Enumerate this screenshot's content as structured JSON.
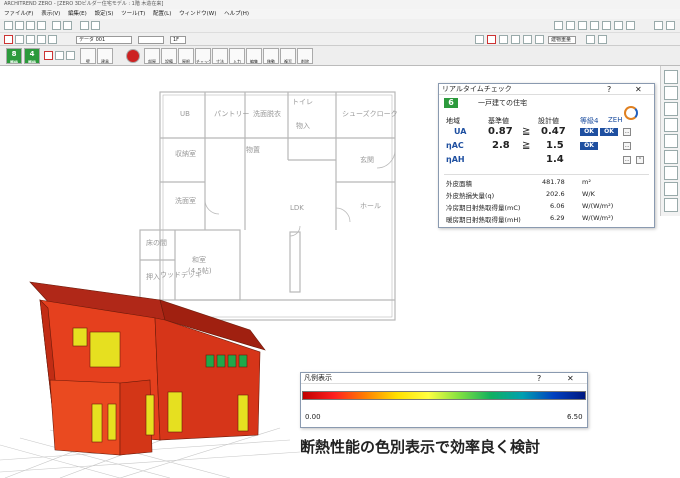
{
  "window": {
    "title": "ARCHITREND ZERO - [ZERO 3Dビルダー住宅モデル : 1階 木造在来]",
    "menu": [
      "ファイル(F)",
      "表示(V)",
      "編集(E)",
      "設定(S)",
      "ツール(T)",
      "配置(L)",
      "ウィンドウ(W)",
      "ヘルプ(H)"
    ]
  },
  "toolbar": {
    "grade_main": "8",
    "grade_sub": "4",
    "grade_main_label": "等級",
    "grade_sub_label": "等級",
    "floor_combo": "1F",
    "layer_combo": "データ 001",
    "view_combo": "建物重量",
    "buttons": [
      "壁",
      "建具",
      "部屋",
      "設備",
      "屋根",
      "チェック",
      "寸法",
      "入力",
      "編集",
      "移動",
      "複写",
      "削除"
    ]
  },
  "floorplan": {
    "rooms": [
      "UB",
      "パントリー",
      "洗面脱衣",
      "トイレ",
      "物入",
      "シューズクローク",
      "物置",
      "収納室",
      "玄関",
      "洗面室",
      "LDK",
      "ホール",
      "和室",
      "(4.5帖)",
      "床の間",
      "押入",
      "ウッドデッキ"
    ]
  },
  "realtime_check": {
    "title": "リアルタイムチェック",
    "help": "?",
    "close": "✕",
    "grade": "6",
    "building_type": "一戸建ての住宅",
    "col_region": "地域",
    "col_standard": "基準値",
    "col_design": "設計値",
    "grade_label": "等級4",
    "zeh_label": "ZEH",
    "rows": [
      {
        "label": "UA",
        "standard": "0.87",
        "op": "≧",
        "design": "0.47",
        "ok1": "OK",
        "ok2": "OK"
      },
      {
        "label": "ηAC",
        "standard": "2.8",
        "op": "≧",
        "design": "1.5",
        "ok1": "OK",
        "ok2": ""
      },
      {
        "label": "ηAH",
        "standard": "",
        "op": "",
        "design": "1.4",
        "ok1": "",
        "ok2": ""
      }
    ],
    "metrics": [
      {
        "label": "外皮面積",
        "value": "481.78",
        "unit": "m²"
      },
      {
        "label": "外皮熱損失量(q)",
        "value": "202.6",
        "unit": "W/K"
      },
      {
        "label": "冷房期日射熱取得量(mC)",
        "value": "6.06",
        "unit": "W/(W/m²)"
      },
      {
        "label": "暖房期日射熱取得量(mH)",
        "value": "6.29",
        "unit": "W/(W/m²)"
      }
    ]
  },
  "legend": {
    "title": "凡例表示",
    "help": "?",
    "close": "✕",
    "min": "0.00",
    "max": "6.50"
  },
  "caption": "断熱性能の色別表示で効率良く検討",
  "colors": {
    "grade_green": "#2c9a3c",
    "ok_blue": "#1e4fa0",
    "house_red": "#e8391e",
    "house_yellow": "#e6e020",
    "window_green": "#1fa84a"
  }
}
